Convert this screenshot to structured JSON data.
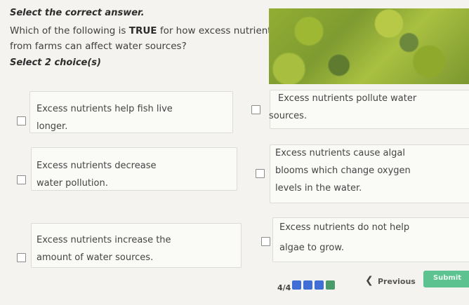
{
  "header": {
    "instruction": "Select the correct answer."
  },
  "question": {
    "prefix": "Which of the following is ",
    "emphasis": "TRUE",
    "suffix": " for how excess nutrients from farms can affect water sources?"
  },
  "select_count": "Select 2 choice(s)",
  "options": [
    {
      "line1": "Excess nutrients help fish live",
      "line2": "longer."
    },
    {
      "line1": "Excess nutrients pollute water",
      "line2": "sources."
    },
    {
      "line1": "Excess nutrients decrease",
      "line2": "water pollution."
    },
    {
      "line1": "Excess nutrients cause algal",
      "line2": "blooms which change oxygen",
      "line3": "levels in the water."
    },
    {
      "line1": "Excess nutrients increase the",
      "line2": "amount of water sources."
    },
    {
      "line1": "Excess nutrients do not help",
      "line2": "algae to grow."
    }
  ],
  "footer": {
    "progress": "4/4",
    "previous_label": "Previous",
    "submit_label": "Submit"
  },
  "colors": {
    "progress_active": "#4a9a6a",
    "progress_inactive": "#3f6fd6",
    "submit": "#5cc28f"
  }
}
